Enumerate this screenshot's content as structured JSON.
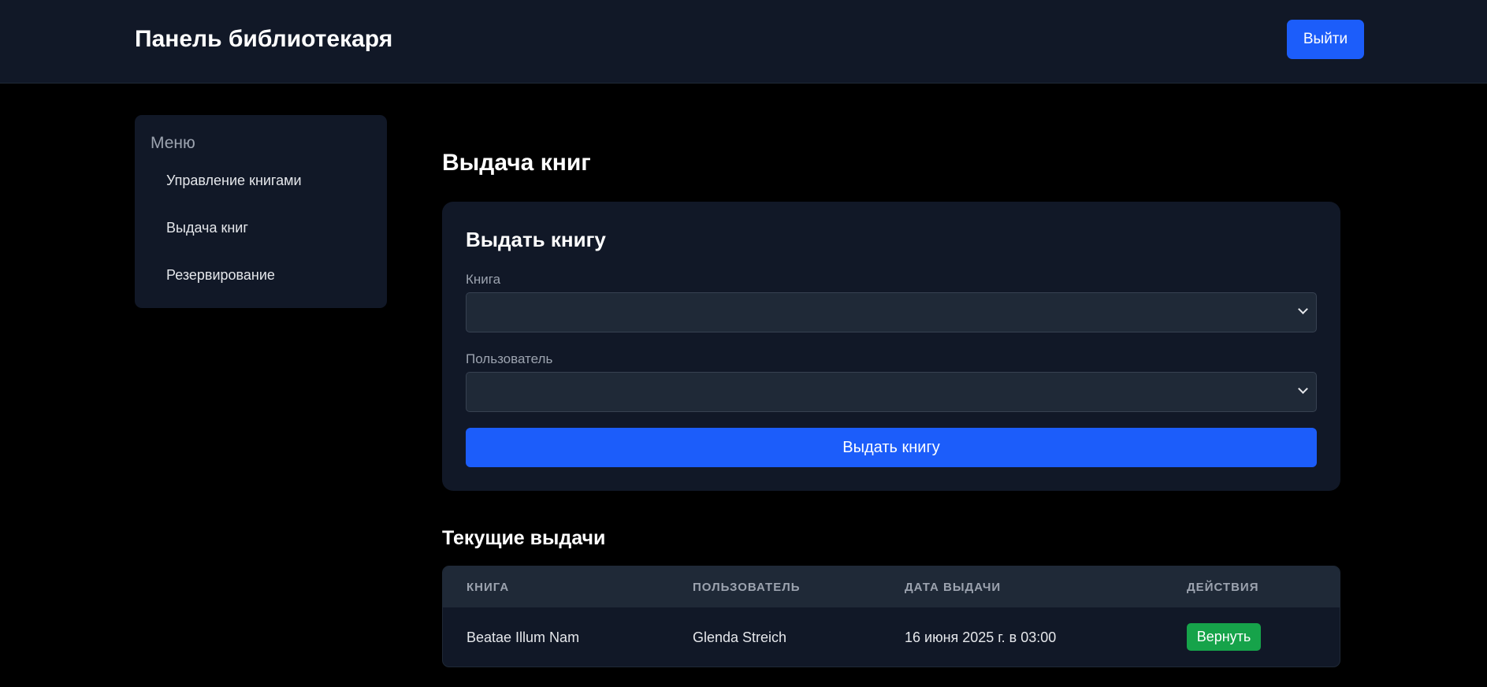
{
  "header": {
    "title": "Панель библиотекаря",
    "logout_label": "Выйти"
  },
  "sidebar": {
    "title": "Меню",
    "items": [
      {
        "label": "Управление книгами"
      },
      {
        "label": "Выдача книг"
      },
      {
        "label": "Резервирование"
      }
    ]
  },
  "main": {
    "title": "Выдача книг",
    "form": {
      "title": "Выдать книгу",
      "book_label": "Книга",
      "book_value": "",
      "user_label": "Пользователь",
      "user_value": "",
      "submit_label": "Выдать книгу"
    },
    "loans": {
      "title": "Текущие выдачи",
      "columns": [
        "Книга",
        "Пользователь",
        "Дата выдачи",
        "Действия"
      ],
      "rows": [
        {
          "book": "Beatae Illum Nam",
          "user": "Glenda Streich",
          "date": "16 июня 2025 г. в 03:00",
          "action_label": "Вернуть"
        }
      ]
    }
  },
  "colors": {
    "accent": "#1c5dfa",
    "success": "#16a34a",
    "panel": "#111827",
    "background": "#000000"
  }
}
